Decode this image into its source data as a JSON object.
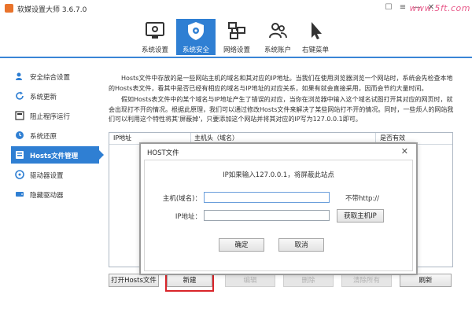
{
  "window": {
    "title": "软媒设置大师 3.6.7.0",
    "watermark": "www.5ft.com",
    "controls": {
      "skin": "☐",
      "menu": "≡",
      "minimize": "—",
      "close": "✕"
    }
  },
  "toolbar": {
    "items": [
      {
        "label": "系统设置",
        "icon": "system-settings-icon"
      },
      {
        "label": "系统安全",
        "icon": "shield-gear-icon",
        "active": true
      },
      {
        "label": "网络设置",
        "icon": "network-icon"
      },
      {
        "label": "系统账户",
        "icon": "users-icon"
      },
      {
        "label": "右键菜单",
        "icon": "cursor-icon"
      }
    ]
  },
  "sidebar": {
    "items": [
      {
        "label": "安全综合设置",
        "icon": "person-shield-icon"
      },
      {
        "label": "系统更新",
        "icon": "refresh-icon"
      },
      {
        "label": "阻止程序运行",
        "icon": "block-icon"
      },
      {
        "label": "系统还原",
        "icon": "restore-icon"
      },
      {
        "label": "Hosts文件管理",
        "icon": "hosts-icon",
        "active": true
      },
      {
        "label": "驱动器设置",
        "icon": "drive-icon"
      },
      {
        "label": "隐藏驱动器",
        "icon": "hidden-drive-icon"
      }
    ]
  },
  "description": {
    "p1": "Hosts文件中存放的是一些网站主机的域名和其对应的IP地址。当我们在使用浏览器浏览一个网站时，系统会先检查本地的Hosts表文件，看其中是否已经有相应的域名与IP地址的对应关系，如果有就会直接采用，因而会节约大量时间。",
    "p2": "假如Hosts表文件中的某个域名与IP地址产生了错误的对应，当你在浏览器中输入这个域名试图打开其对应的网页时，就会出现打不开的情况。根据此原理，我们可以通过修改Hosts文件来解决了某些网站打不开的情况。同时，一些烦人的网站我们可以利用这个特性将其'屏蔽掉'，只要添加这个网站并将其对应的IP写为127.0.0.1即可。"
  },
  "table": {
    "columns": [
      "IP地址",
      "主机头（域名）",
      "是否有效"
    ]
  },
  "dialog": {
    "title": "HOST文件",
    "close": "✕",
    "hint": "IP如果输入127.0.0.1，将屏蔽此站点",
    "host_label": "主机(域名)：",
    "host_value": "",
    "no_http": "不带http://",
    "ip_label": "IP地址：",
    "ip_value": "",
    "get_ip_button": "获取主机IP",
    "ok_button": "确定",
    "cancel_button": "取消"
  },
  "actions": {
    "open_hosts": "打开Hosts文件",
    "new": "新建",
    "edit": "编辑",
    "delete": "删除",
    "clear_all": "清除所有",
    "refresh": "刷新"
  },
  "colors": {
    "accent": "#2f7fd3",
    "highlight": "#d9252a",
    "app_icon": "#e9732b"
  }
}
